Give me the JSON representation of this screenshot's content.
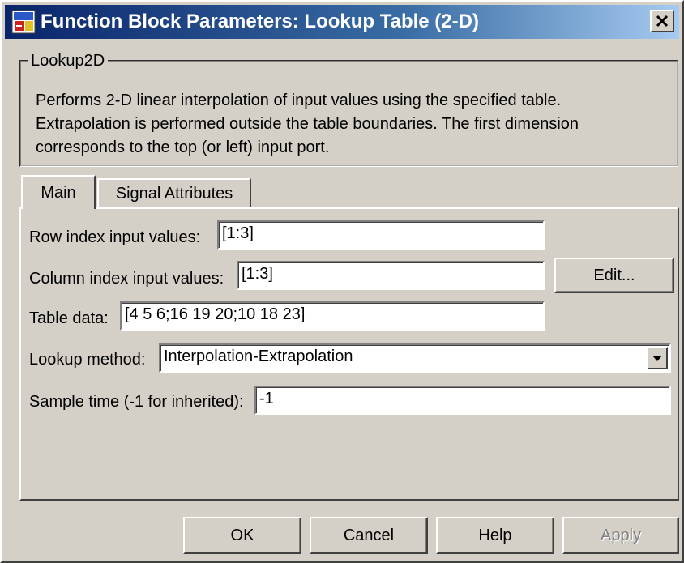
{
  "window": {
    "title": "Function Block Parameters: Lookup Table (2-D)",
    "close_label": "✕"
  },
  "block": {
    "group_title": "Lookup2D",
    "description": [
      "Performs 2-D linear interpolation of input values using the specified table.",
      "Extrapolation is performed outside the table boundaries.  The first dimension",
      "corresponds to the top (or left) input port."
    ]
  },
  "tabs": [
    {
      "label": "Main",
      "active": true
    },
    {
      "label": "Signal Attributes",
      "active": false
    }
  ],
  "params": {
    "row_index": {
      "label": "Row index input values:",
      "value": "[1:3]"
    },
    "col_index": {
      "label": "Column index input values:",
      "value": "[1:3]"
    },
    "edit_label": "Edit...",
    "table_data": {
      "label": "Table data:",
      "value": "[4 5 6;16 19 20;10 18 23]"
    },
    "lookup_method": {
      "label": "Lookup method:",
      "value": "Interpolation-Extrapolation"
    },
    "sample_time": {
      "label": "Sample time (-1 for inherited):",
      "value": "-1"
    }
  },
  "buttons": {
    "ok": "OK",
    "cancel": "Cancel",
    "help": "Help",
    "apply": "Apply"
  },
  "icons": {
    "app": "simulink-block-icon",
    "close": "close-icon",
    "dropdown": "chevron-down-icon"
  }
}
